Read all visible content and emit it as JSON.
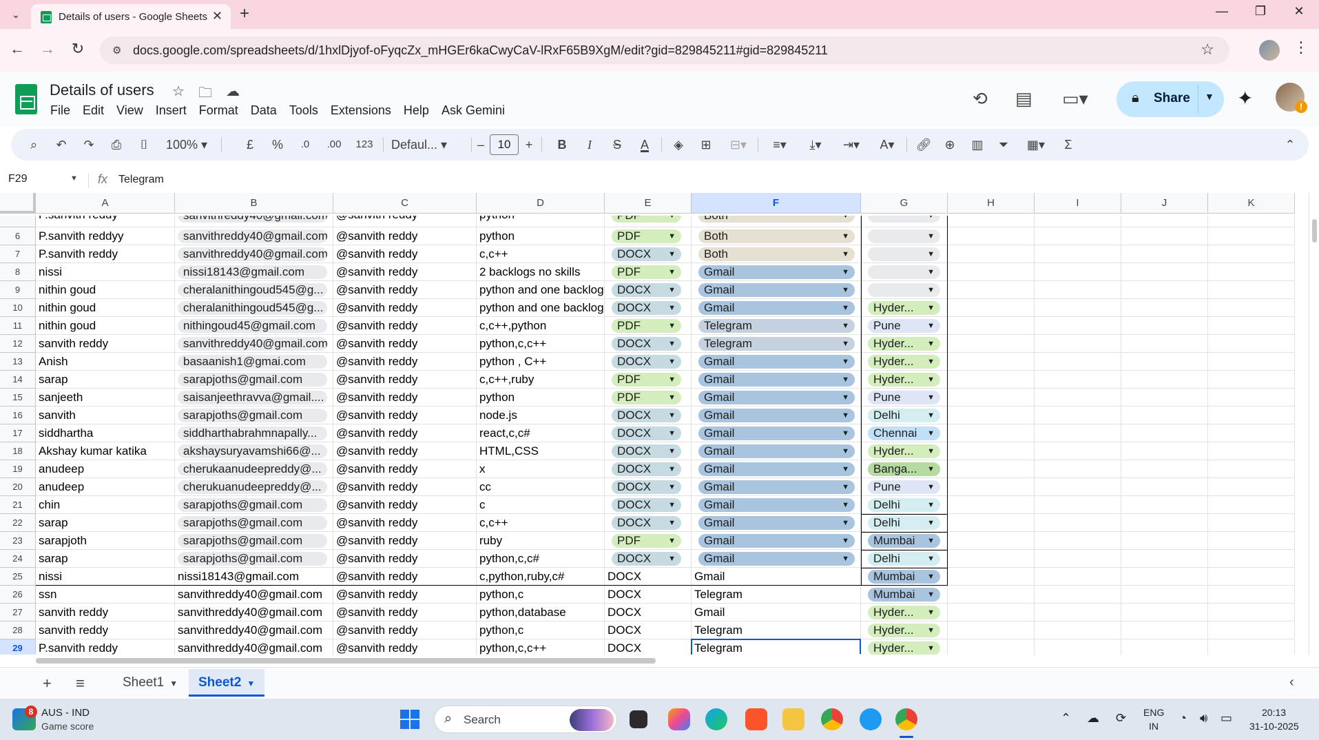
{
  "browser": {
    "tab_title": "Details of users - Google Sheets",
    "url": "docs.google.com/spreadsheets/d/1hxlDjyof-oFyqcZx_mHGEr6kaCwyCaV-lRxF65B9XgM/edit?gid=829845211#gid=829845211"
  },
  "doc": {
    "title": "Details of users",
    "menus": [
      "File",
      "Edit",
      "View",
      "Insert",
      "Format",
      "Data",
      "Tools",
      "Extensions",
      "Help",
      "Ask Gemini"
    ],
    "share_label": "Share"
  },
  "toolbar": {
    "zoom": "100%",
    "currency": "£",
    "percent": "%",
    "dec_decrease": ".0",
    "dec_increase": ".00",
    "number_format": "123",
    "font": "Defaul...",
    "font_size": "10"
  },
  "formula_bar": {
    "cell_ref": "F29",
    "content": "Telegram"
  },
  "grid": {
    "columns": [
      "A",
      "B",
      "C",
      "D",
      "E",
      "F",
      "G",
      "H",
      "I",
      "J",
      "K"
    ],
    "selected_column": "F",
    "selected_row": "29",
    "partial_top_row": [
      "P.sanvith reddy",
      "sanvithreddy40@gmail.com",
      "@sanvith reddy",
      "python",
      "PDF",
      "Both",
      ""
    ],
    "rows": [
      {
        "n": "6",
        "a": "P.sanvith reddyy",
        "b": "sanvithreddy40@gmail.com",
        "c": "@sanvith reddy",
        "d": "python",
        "e": "PDF",
        "f": "Both",
        "g": ""
      },
      {
        "n": "7",
        "a": "P.sanvith reddy",
        "b": "sanvithreddy40@gmail.com",
        "c": "@sanvith reddy",
        "d": "c,c++",
        "e": "DOCX",
        "f": "Both",
        "g": ""
      },
      {
        "n": "8",
        "a": "nissi",
        "b": "nissi18143@gmail.com",
        "c": "@sanvith reddy",
        "d": "2 backlogs no skills",
        "e": "PDF",
        "f": "Gmail",
        "g": ""
      },
      {
        "n": "9",
        "a": "nithin goud",
        "b": "cheralanithingoud545@g...",
        "c": "@sanvith reddy",
        "d": "python and one backlog",
        "e": "DOCX",
        "f": "Gmail",
        "g": ""
      },
      {
        "n": "10",
        "a": "nithin goud",
        "b": "cheralanithingoud545@g...",
        "c": "@sanvith reddy",
        "d": "python and one backlog",
        "e": "DOCX",
        "f": "Gmail",
        "g": "Hyder..."
      },
      {
        "n": "11",
        "a": "nithin goud",
        "b": "nithingoud45@gmail.com",
        "c": "@sanvith reddy",
        "d": "c,c++,python",
        "e": "PDF",
        "f": "Telegram",
        "g": "Pune"
      },
      {
        "n": "12",
        "a": "sanvith reddy",
        "b": "sanvithreddy40@gmail.com",
        "c": "@sanvith reddy",
        "d": "python,c,c++",
        "e": "DOCX",
        "f": "Telegram",
        "g": "Hyder..."
      },
      {
        "n": "13",
        "a": "Anish",
        "b": "basaanish1@gmai.com",
        "c": "@sanvith reddy",
        "d": "python , C++",
        "e": "DOCX",
        "f": "Gmail",
        "g": "Hyder..."
      },
      {
        "n": "14",
        "a": "sarap",
        "b": "sarapjoths@gmail.com",
        "c": "@sanvith reddy",
        "d": "c,c++,ruby",
        "e": "PDF",
        "f": "Gmail",
        "g": "Hyder..."
      },
      {
        "n": "15",
        "a": "sanjeeth",
        "b": "saisanjeethravva@gmail....",
        "c": "@sanvith reddy",
        "d": "python",
        "e": "PDF",
        "f": "Gmail",
        "g": "Pune"
      },
      {
        "n": "16",
        "a": "sanvith",
        "b": "sarapjoths@gmail.com",
        "c": "@sanvith reddy",
        "d": "node.js",
        "e": "DOCX",
        "f": "Gmail",
        "g": "Delhi"
      },
      {
        "n": "17",
        "a": "siddhartha",
        "b": "siddharthabrahmnapally...",
        "c": "@sanvith reddy",
        "d": "react,c,c#",
        "e": "DOCX",
        "f": "Gmail",
        "g": "Chennai"
      },
      {
        "n": "18",
        "a": "Akshay kumar katika",
        "b": "akshaysuryavamshi66@...",
        "c": "@sanvith reddy",
        "d": "HTML,CSS",
        "e": "DOCX",
        "f": "Gmail",
        "g": "Hyder..."
      },
      {
        "n": "19",
        "a": "anudeep",
        "b": "cherukaanudeepreddy@...",
        "c": "@sanvith reddy",
        "d": "x",
        "e": "DOCX",
        "f": "Gmail",
        "g": "Banga..."
      },
      {
        "n": "20",
        "a": "anudeep",
        "b": "cherukuanudeepreddy@...",
        "c": "@sanvith reddy",
        "d": "cc",
        "e": "DOCX",
        "f": "Gmail",
        "g": "Pune"
      },
      {
        "n": "21",
        "a": "chin",
        "b": "sarapjoths@gmail.com",
        "c": "@sanvith reddy",
        "d": "c",
        "e": "DOCX",
        "f": "Gmail",
        "g": "Delhi"
      },
      {
        "n": "22",
        "a": "sarap",
        "b": "sarapjoths@gmail.com",
        "c": "@sanvith reddy",
        "d": "c,c++",
        "e": "DOCX",
        "f": "Gmail",
        "g": "Delhi"
      },
      {
        "n": "23",
        "a": "sarapjoth",
        "b": "sarapjoths@gmail.com",
        "c": "@sanvith reddy",
        "d": "ruby",
        "e": "PDF",
        "f": "Gmail",
        "g": "Mumbai"
      },
      {
        "n": "24",
        "a": "sarap",
        "b": "sarapjoths@gmail.com",
        "c": "@sanvith reddy",
        "d": "python,c,c#",
        "e": "DOCX",
        "f": "Gmail",
        "g": "Delhi"
      },
      {
        "n": "25",
        "a": "nissi",
        "b": "nissi18143@gmail.com",
        "c": "@sanvith reddy",
        "d": "c,python,ruby,c#",
        "e": "DOCX",
        "f": "Gmail",
        "g": "Mumbai"
      },
      {
        "n": "26",
        "a": "ssn",
        "b": "sanvithreddy40@gmail.com",
        "c": "@sanvith reddy",
        "d": "python,c",
        "e": "DOCX",
        "f": "Telegram",
        "g": "Mumbai"
      },
      {
        "n": "27",
        "a": "sanvith reddy",
        "b": "sanvithreddy40@gmail.com",
        "c": "@sanvith reddy",
        "d": "python,database",
        "e": "DOCX",
        "f": "Gmail",
        "g": "Hyder..."
      },
      {
        "n": "28",
        "a": "sanvith reddy",
        "b": "sanvithreddy40@gmail.com",
        "c": "@sanvith reddy",
        "d": "python,c",
        "e": "DOCX",
        "f": "Telegram",
        "g": "Hyder..."
      },
      {
        "n": "29",
        "a": "P.sanvith reddy",
        "b": "sanvithreddy40@gmail.com",
        "c": "@sanvith reddy",
        "d": "python,c,c++",
        "e": "DOCX",
        "f": "Telegram",
        "g": "Hyder..."
      }
    ],
    "next_row_label": "30"
  },
  "sheets": {
    "tabs": [
      "Sheet1",
      "Sheet2"
    ],
    "active": "Sheet2"
  },
  "taskbar": {
    "news_badge": "8",
    "news_title": "AUS - IND",
    "news_subtitle": "Game score",
    "search_placeholder": "Search",
    "lang_line1": "ENG",
    "lang_line2": "IN",
    "time": "20:13",
    "date": "31-10-2025"
  },
  "colors": {
    "chip_pdf": "#d4edbc",
    "chip_docx": "#c6dbe1",
    "chip_both": "#e6e0d3",
    "chip_gmail": "#a8c4de",
    "chip_telegram": "#c6d1e0",
    "chip_empty": "#e8eaed",
    "chip_hyderabad": "#d4edbc",
    "chip_pune": "#dee5f5",
    "chip_delhi": "#d4edf0",
    "chip_chennai": "#bfe0f6",
    "chip_bangalore": "#b6dba0",
    "chip_mumbai": "#a8c4de",
    "accent": "#0b57d0"
  }
}
